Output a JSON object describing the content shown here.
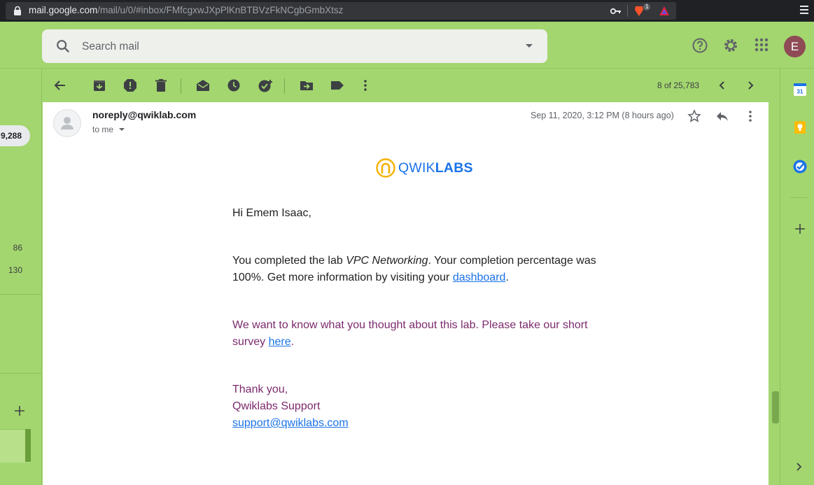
{
  "browser": {
    "url_domain": "mail.google.com",
    "url_path": "/mail/u/0/#inbox/FMfcgxwJXpPlKnBTBVzFkNCgbGmbXtsz",
    "brave_badge": "1"
  },
  "search": {
    "placeholder": "Search mail"
  },
  "account": {
    "initial": "E"
  },
  "toolbar": {
    "count": "8 of 25,783"
  },
  "sidebar": {
    "badge": "9,288",
    "counts": [
      "86",
      "130"
    ]
  },
  "message": {
    "sender": "noreply@qwiklab.com",
    "to": "to me",
    "date": "Sep 11, 2020, 3:12 PM (8 hours ago)",
    "logo_prefix": "QWIK",
    "logo_suffix": "LABS",
    "greeting": "Hi Emem Isaac,",
    "para1_a": "You completed the lab ",
    "para1_lab": "VPC Networking",
    "para1_b": ". Your completion percentage was 100%. Get more information by visiting your ",
    "para1_link": "dashboard",
    "para1_c": ".",
    "para2_a": "We want to know what you thought about this lab. Please take our short survey ",
    "para2_link": "here",
    "para2_c": ".",
    "thanks": "Thank you,",
    "signature": "Qwiklabs Support",
    "support_email": "support@qwiklabs.com"
  },
  "colors": {
    "background": "#a3d66f",
    "purple_text": "#7b2a6d",
    "link": "#1a73e8"
  },
  "icons": [
    "lock-icon",
    "key-icon",
    "brave-icon",
    "triangle-icon",
    "menu-icon",
    "search-icon",
    "help-icon",
    "settings-icon",
    "apps-icon",
    "back-icon",
    "archive-icon",
    "report-spam-icon",
    "delete-icon",
    "mark-unread-icon",
    "snooze-icon",
    "add-task-icon",
    "move-to-icon",
    "label-icon",
    "more-vert-icon",
    "chevron-left-icon",
    "chevron-right-icon",
    "star-icon",
    "reply-icon",
    "calendar-icon",
    "keep-icon",
    "tasks-icon",
    "plus-icon"
  ]
}
